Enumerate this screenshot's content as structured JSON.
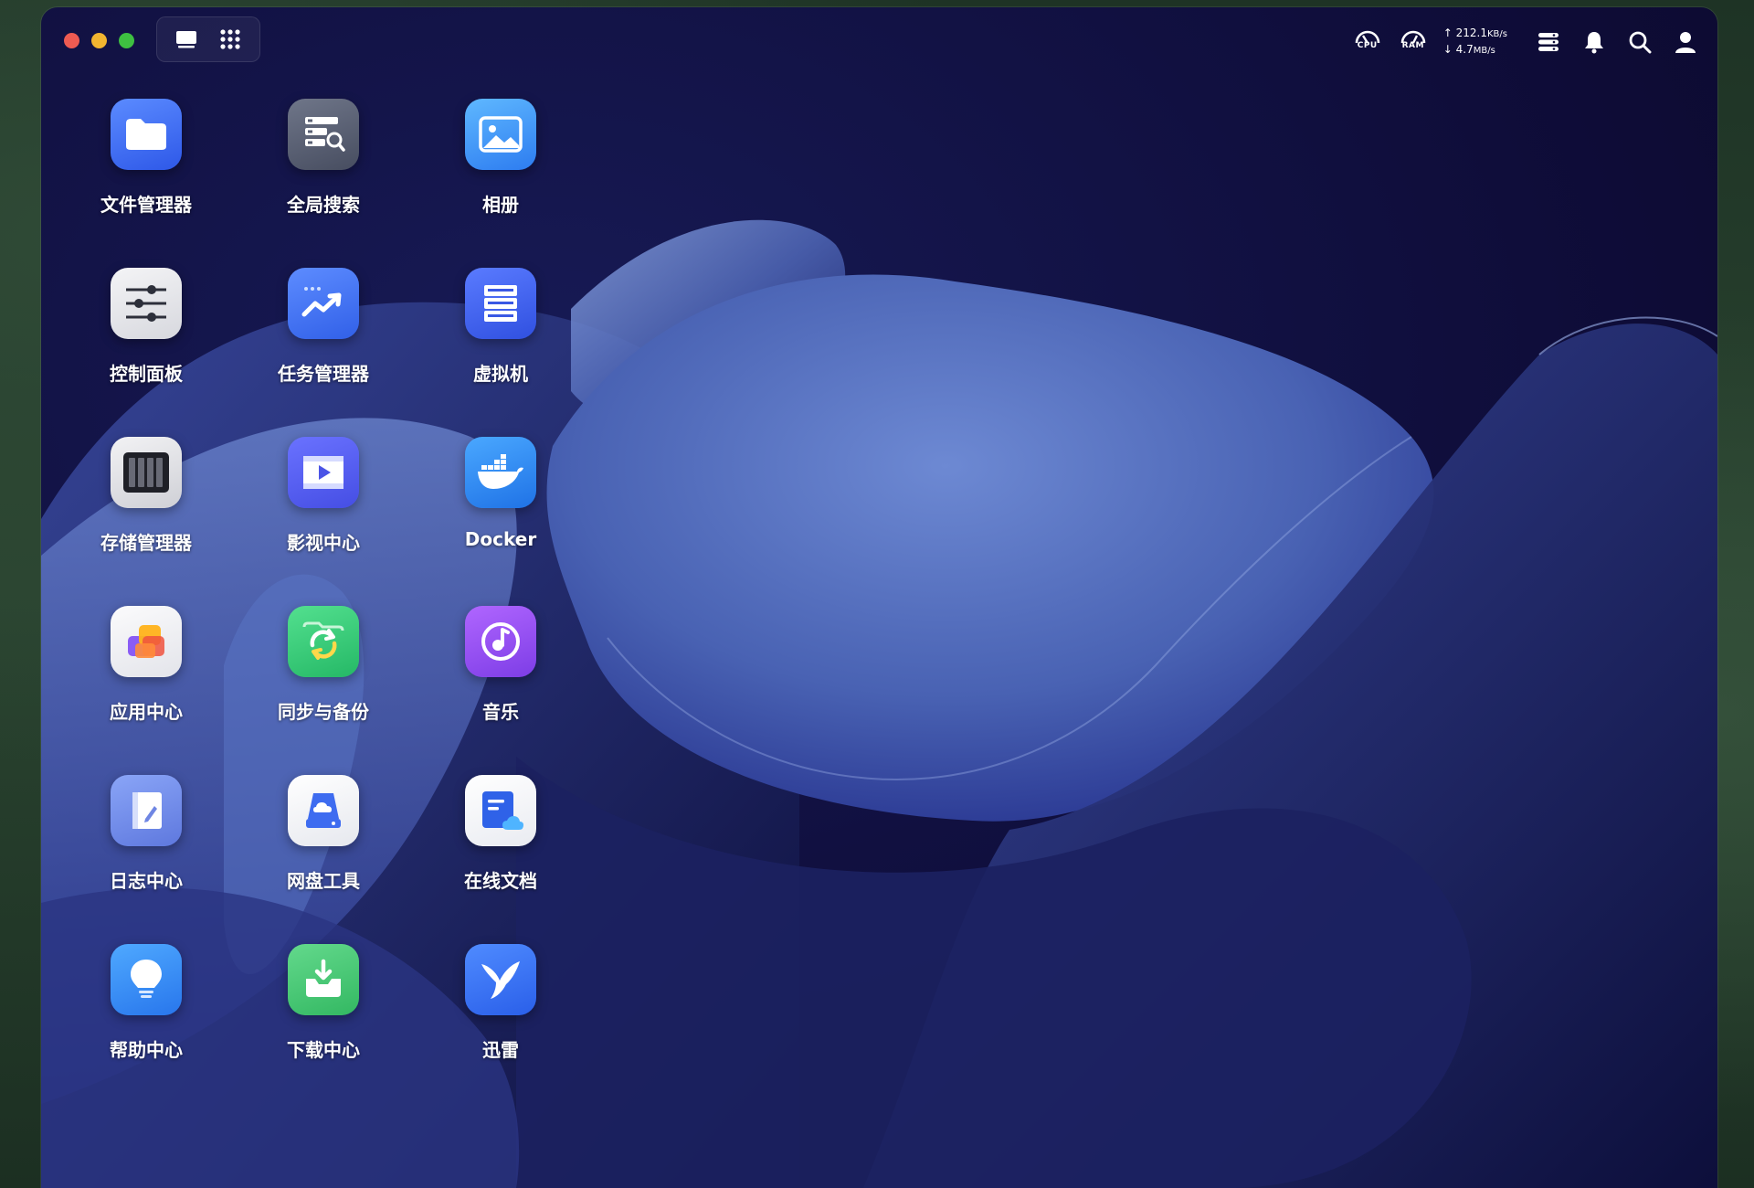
{
  "window": {
    "traffic_lights": [
      {
        "name": "close",
        "color": "#ee5b52"
      },
      {
        "name": "minimize",
        "color": "#f2b530"
      },
      {
        "name": "maximize",
        "color": "#3ec041"
      }
    ],
    "view_switch": {
      "icons": [
        "desktop-icon",
        "app-grid-icon"
      ]
    }
  },
  "tray": {
    "cpu_label": "CPU",
    "ram_label": "RAM",
    "upload_arrow": "↑",
    "upload_value": "212.1",
    "upload_unit": "KB/s",
    "download_arrow": "↓",
    "download_value": "4.7",
    "download_unit": "MB/s",
    "icons": [
      "widgets-icon",
      "bell-icon",
      "search-icon",
      "user-icon"
    ]
  },
  "apps": [
    {
      "label": "文件管理器",
      "icon": "folder-icon"
    },
    {
      "label": "全局搜索",
      "icon": "global-search-icon"
    },
    {
      "label": "相册",
      "icon": "photo-icon"
    },
    {
      "label": "控制面板",
      "icon": "sliders-icon"
    },
    {
      "label": "任务管理器",
      "icon": "trend-icon"
    },
    {
      "label": "虚拟机",
      "icon": "server-icon"
    },
    {
      "label": "存储管理器",
      "icon": "storage-icon"
    },
    {
      "label": "影视中心",
      "icon": "video-icon"
    },
    {
      "label": "Docker",
      "icon": "docker-icon"
    },
    {
      "label": "应用中心",
      "icon": "app-center-icon"
    },
    {
      "label": "同步与备份",
      "icon": "sync-icon"
    },
    {
      "label": "音乐",
      "icon": "music-icon"
    },
    {
      "label": "日志中心",
      "icon": "log-icon"
    },
    {
      "label": "网盘工具",
      "icon": "cloud-drive-icon"
    },
    {
      "label": "在线文档",
      "icon": "online-doc-icon"
    },
    {
      "label": "帮助中心",
      "icon": "help-bulb-icon"
    },
    {
      "label": "下载中心",
      "icon": "download-icon"
    },
    {
      "label": "迅雷",
      "icon": "thunder-bird-icon"
    }
  ]
}
